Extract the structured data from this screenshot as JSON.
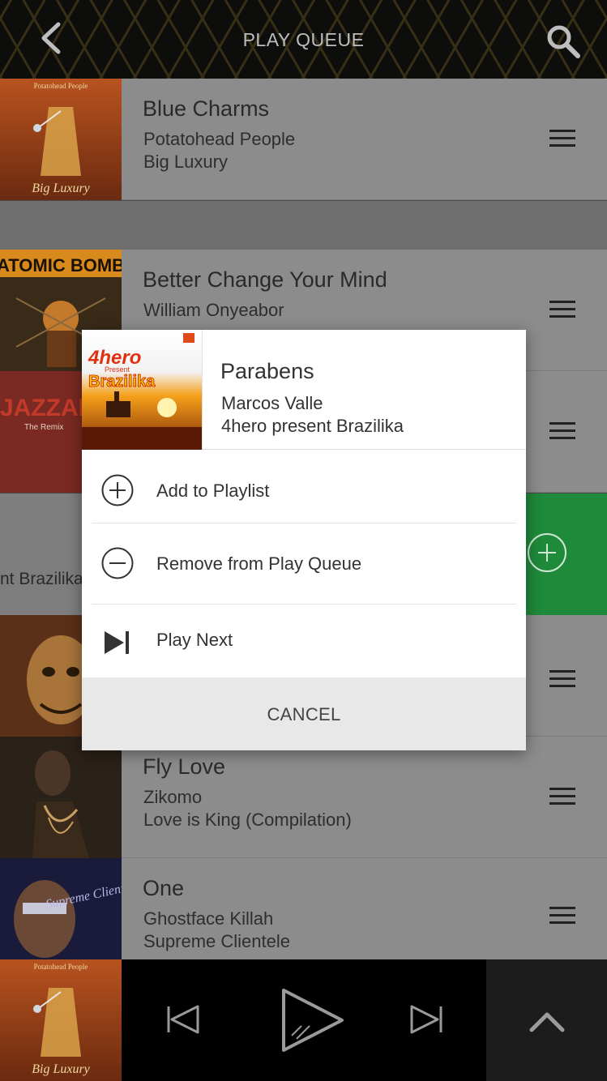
{
  "header": {
    "title": "PLAY QUEUE"
  },
  "queue": [
    {
      "title": "Blue Charms",
      "artist": "Potatohead People",
      "album": "Big Luxury"
    },
    {
      "title": "Better Change Your Mind",
      "artist": "William Onyeabor",
      "album": ""
    },
    {
      "title": "",
      "artist": "",
      "album": ""
    },
    {
      "partial_album": "nt Brazilika"
    },
    {
      "title": "",
      "artist": "",
      "album": ""
    },
    {
      "title": "Fly Love",
      "artist": "Zikomo",
      "album": "Love is King (Compilation)"
    },
    {
      "title": "One",
      "artist": "Ghostface Killah",
      "album": "Supreme Clientele"
    }
  ],
  "art_text": {
    "potatohead_label": "Potatohead People",
    "big_luxury": "Big Luxury",
    "atomic_bomb": "ATOMIC BOMB",
    "jazzanova": "JAZZAN",
    "jazzanova_sub": "The Remix",
    "fourhero": "4hero",
    "present": "Present",
    "brazilika": "Brazilika",
    "supreme": "Supreme Clientele"
  },
  "modal": {
    "title": "Parabens",
    "artist": "Marcos Valle",
    "album": "4hero present Brazilika",
    "options": [
      {
        "label": "Add to Playlist",
        "icon": "plus-circle-icon"
      },
      {
        "label": "Remove from Play Queue",
        "icon": "minus-circle-icon"
      },
      {
        "label": "Play Next",
        "icon": "play-next-icon"
      }
    ],
    "cancel": "CANCEL"
  },
  "colors": {
    "accent_green": "#1f8a3a",
    "header_pattern": "#c8a43a"
  }
}
